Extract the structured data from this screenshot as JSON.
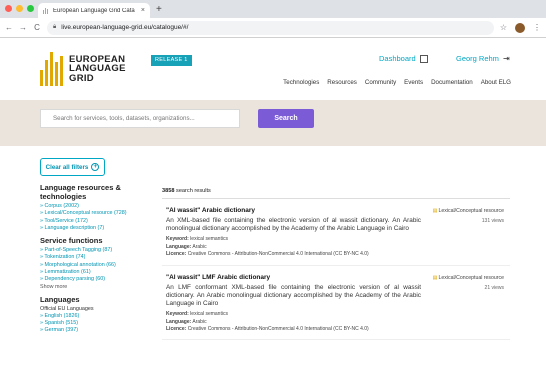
{
  "browser": {
    "tab_title": "European Language Grid Cata",
    "tab_close": "×",
    "new_tab": "+",
    "url": "live.european-language-grid.eu/catalogue/#/",
    "back": "←",
    "forward": "→",
    "reload": "C",
    "star": "☆",
    "menu": "⋮"
  },
  "site": {
    "logo_lines": [
      "EUROPEAN",
      "LANGUAGE",
      "GRID"
    ],
    "release_badge": "RELEASE 1",
    "dashboard_label": "Dashboard",
    "user_name": "Georg Rehm",
    "nav": [
      "Technologies",
      "Resources",
      "Community",
      "Events",
      "Documentation",
      "About ELG"
    ]
  },
  "search": {
    "placeholder": "Search for services, tools, datasets, organizations...",
    "button_label": "Search"
  },
  "filters": {
    "clear_label": "Clear all filters",
    "sections": [
      {
        "title": "Language resources & technologies",
        "items": [
          "» Corpus (2002)",
          "» Lexical/Conceptual resource (728)",
          "» Tool/Service (172)",
          "» Language description (7)"
        ]
      },
      {
        "title": "Service functions",
        "items": [
          "» Part-of-Speech Tagging (87)",
          "» Tokenization (74)",
          "» Morphological annotation (66)",
          "» Lemmatization (61)",
          "» Dependency parsing (60)"
        ],
        "more": "Show more"
      },
      {
        "title": "Languages",
        "subhead": "Official EU Languages",
        "items": [
          "» English (1826)",
          "» Spanish (515)",
          "» German (397)"
        ]
      }
    ]
  },
  "results": {
    "count": "3858",
    "count_suffix": "search results",
    "items": [
      {
        "title": "\"Al wassit\" Arabic dictionary",
        "description": "An XML-based file containing the electronic version of al wassit dictionary. An Arabic monolingual dictionary accomplished by the Academy of the Arabic Language in Cairo",
        "keyword_label": "Keyword:",
        "keyword": "lexical semantics",
        "language_label": "Language:",
        "language": "Arabic",
        "licence_label": "Licence:",
        "licence": "Creative Commons - Attribution-NonCommercial 4.0 International (CC BY-NC 4.0)",
        "type": "Lexical/Conceptual resource",
        "views": "131 views"
      },
      {
        "title": "\"Al wassit\" LMF Arabic dictionary",
        "description": "An LMF conformant XML-based file containing the electronic version of al wassit dictionary. An Arabic monolingual dictionary accomplished by the Academy of the Arabic Language in Cairo",
        "keyword_label": "Keyword:",
        "keyword": "lexical semantics",
        "language_label": "Language:",
        "language": "Arabic",
        "licence_label": "Licence:",
        "licence": "Creative Commons - Attribution-NonCommercial 4.0 International (CC BY-NC 4.0)",
        "type": "Lexical/Conceptual resource",
        "views": "21 views"
      }
    ]
  },
  "colors": {
    "accent": "#00a7c4",
    "search_button": "#7b5cd6",
    "search_band": "#ebe4dc",
    "logo_gold": "#e0a800"
  }
}
